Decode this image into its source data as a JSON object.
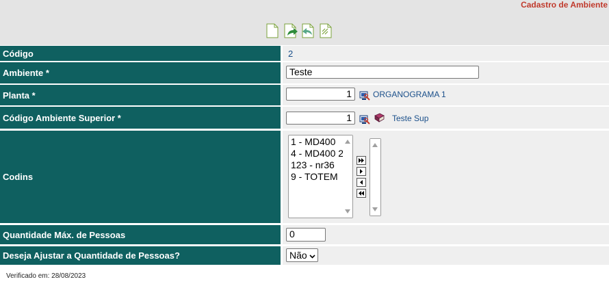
{
  "page": {
    "title": "Cadastro de Ambiente"
  },
  "toolbar": {
    "icons": [
      "new-document-icon",
      "save-document-icon",
      "back-document-icon",
      "search-document-icon"
    ]
  },
  "form": {
    "codigo": {
      "label": "Código",
      "value": "2"
    },
    "ambiente": {
      "label": "Ambiente *",
      "value": "Teste"
    },
    "planta": {
      "label": "Planta *",
      "value": "1",
      "link": "ORGANOGRAMA 1"
    },
    "ambiente_superior": {
      "label": "Código Ambiente Superior *",
      "value": "1",
      "link": "Teste Sup"
    },
    "codins": {
      "label": "Codins",
      "available": [
        "1 - MD400",
        "4 - MD400 2",
        "123 - nr36",
        "9 - TOTEM"
      ],
      "selected": []
    },
    "qtd_max": {
      "label": "Quantidade Máx. de Pessoas",
      "value": "0"
    },
    "ajustar": {
      "label": "Deseja Ajustar a Quantidade de Pessoas?",
      "value": "Não"
    }
  },
  "footer": {
    "text": "Verificado em: 28/08/2023"
  },
  "colors": {
    "label_bg": "#0f6060",
    "value_bg": "#efefef",
    "title": "#c0392b",
    "link": "#1a4f8a"
  }
}
